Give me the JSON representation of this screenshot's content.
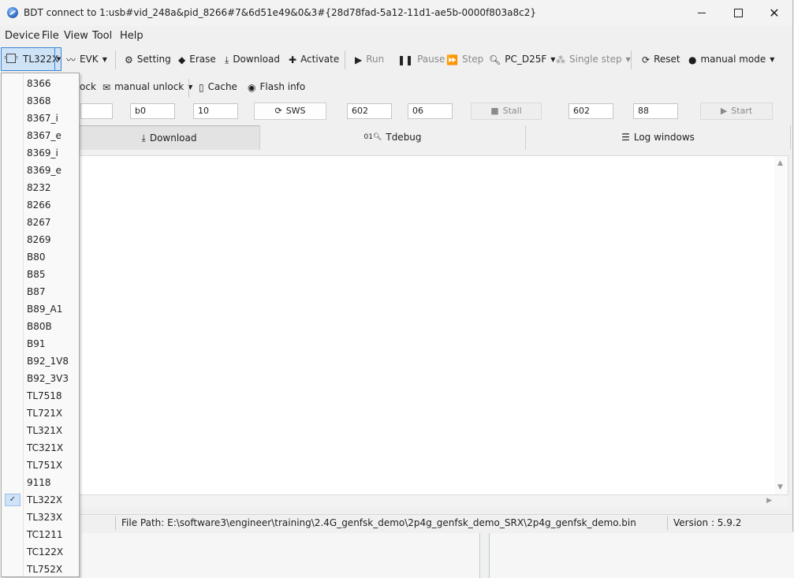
{
  "window": {
    "title": "BDT connect to 1:usb#vid_248a&pid_8266#7&6d51e49&0&3#{28d78fad-5a12-11d1-ae5b-0000f803a8c2}",
    "controls": [
      "minimize",
      "maximize",
      "close"
    ]
  },
  "menubar": {
    "items": [
      "Device",
      "File",
      "View",
      "Tool",
      "Help"
    ]
  },
  "toolbar1": {
    "chip": "TL322X",
    "evk": "EVK",
    "setting": "Setting",
    "erase": "Erase",
    "download": "Download",
    "activate": "Activate",
    "run": "Run",
    "pause": "Pause",
    "step": "Step",
    "pc": "PC_D25F",
    "single_step": "Single step",
    "reset": "Reset",
    "mode": "manual mode"
  },
  "toolbar2": {
    "unlock_partial": "ock",
    "manual_unlock": "manual unlock",
    "cache": "Cache",
    "flash_info": "Flash info"
  },
  "toolbar3": {
    "field1": "",
    "field2": "b0",
    "field3": "10",
    "sws": "SWS",
    "field4": "602",
    "field5": "06",
    "stall": "Stall",
    "field6": "602",
    "field7": "88",
    "start": "Start"
  },
  "tabs": [
    {
      "label": "Download",
      "active": true
    },
    {
      "label": "Tdebug",
      "active": false
    },
    {
      "label": "Log windows",
      "active": false
    }
  ],
  "status": {
    "file_path": "File Path:  E:\\software3\\engineer\\training\\2.4G_genfsk_demo\\2p4g_genfsk_demo_SRX\\2p4g_genfsk_demo.bin",
    "version": "Version : 5.9.2"
  },
  "chip_menu": {
    "items": [
      "8366",
      "8368",
      "8367_i",
      "8367_e",
      "8369_i",
      "8369_e",
      "8232",
      "8266",
      "8267",
      "8269",
      "B80",
      "B85",
      "B87",
      "B89_A1",
      "B80B",
      "B91",
      "B92_1V8",
      "B92_3V3",
      "TL7518",
      "TL721X",
      "TL321X",
      "TC321X",
      "TL751X",
      "9118",
      "TL322X",
      "TL323X",
      "TC1211",
      "TC122X",
      "TL752X"
    ],
    "selected": "TL322X"
  }
}
